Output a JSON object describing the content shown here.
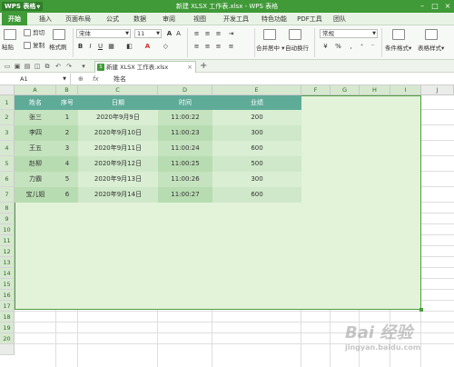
{
  "titlebar": {
    "app_logo": "WPS 表格",
    "window_title": "新建 XLSX 工作表.xlsx - WPS 表格"
  },
  "menu": {
    "tabs": [
      "开始",
      "插入",
      "页面布局",
      "公式",
      "数据",
      "审阅",
      "视图",
      "开发工具",
      "特色功能",
      "PDF工具",
      "团队"
    ],
    "active": "开始"
  },
  "ribbon": {
    "paste_label": "粘贴",
    "cut_label": "剪切",
    "copy_label": "复制",
    "format_painter_label": "格式刷",
    "font_name": "宋体",
    "font_size": "11",
    "bold": "B",
    "italic": "I",
    "underline": "U",
    "merge_center_label": "合并居中",
    "wrap_text_label": "自动换行",
    "number_format": "常规",
    "currency_symbol": "¥",
    "percent_symbol": "%",
    "conditional_format_label": "条件格式",
    "table_style_label": "表格样式"
  },
  "doc_tab": {
    "title": "新建 XLSX 工作表.xlsx",
    "icon_text": "S"
  },
  "formula_bar": {
    "cell_ref": "A1",
    "fx_label": "fx",
    "value": "姓名"
  },
  "sheet": {
    "columns": [
      "A",
      "B",
      "C",
      "D",
      "E",
      "F",
      "G",
      "H",
      "I",
      "J"
    ],
    "rows": [
      "1",
      "2",
      "3",
      "4",
      "5",
      "6",
      "7",
      "8",
      "9",
      "10",
      "11",
      "12",
      "13",
      "14",
      "15",
      "16",
      "17",
      "18",
      "19",
      "20"
    ],
    "header": [
      "姓名",
      "序号",
      "日期",
      "时间",
      "业绩"
    ],
    "data": [
      [
        "张三",
        "1",
        "2020年9月9日",
        "11:00:22",
        "200"
      ],
      [
        "李四",
        "2",
        "2020年9月10日",
        "11:00:23",
        "300"
      ],
      [
        "王五",
        "3",
        "2020年9月11日",
        "11:00:24",
        "600"
      ],
      [
        "赵柳",
        "4",
        "2020年9月12日",
        "11:00:25",
        "500"
      ],
      [
        "力霸",
        "5",
        "2020年9月13日",
        "11:00:26",
        "300"
      ],
      [
        "宝儿姐",
        "6",
        "2020年9月14日",
        "11:00:27",
        "600"
      ]
    ]
  },
  "watermark": {
    "text": "Bai 经验",
    "sub": "jingyan.baidu.com"
  },
  "colors": {
    "brand": "#3f9a37",
    "table_header": "#5eab98",
    "band_light": "#d6ecd0",
    "band_dark": "#c9e5c3",
    "selection": "#e2f3da"
  }
}
